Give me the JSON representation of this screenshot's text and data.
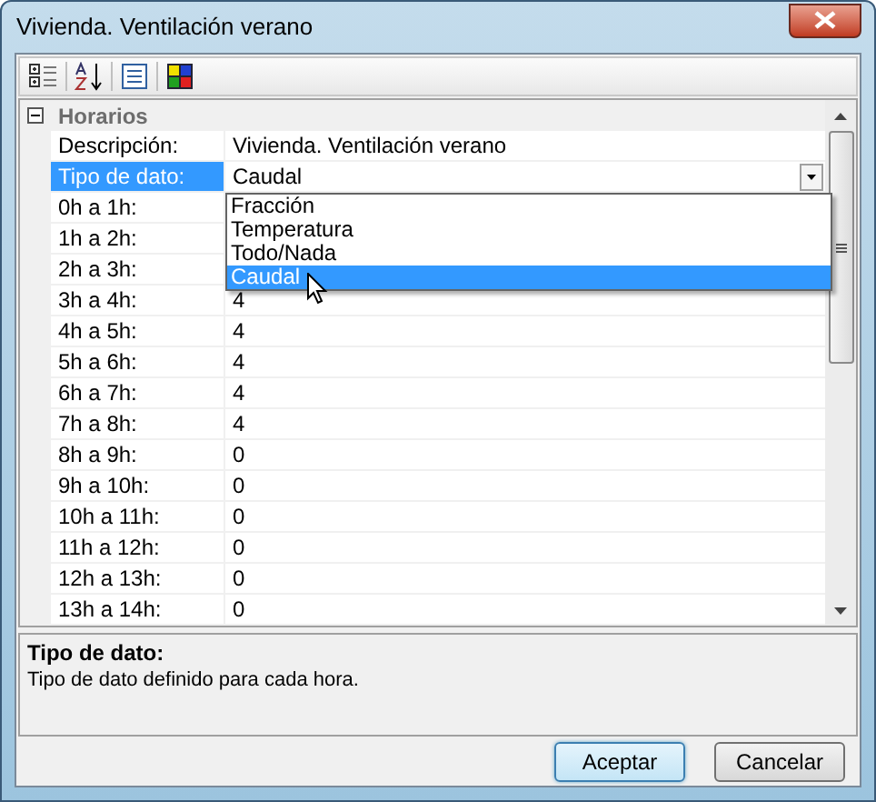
{
  "window": {
    "title": "Vivienda. Ventilación verano"
  },
  "grid": {
    "category": {
      "label": "Horarios",
      "expanded": true
    },
    "rows": [
      {
        "label": "Descripción:",
        "value": "Vivienda. Ventilación verano",
        "selected": false
      },
      {
        "label": "Tipo de dato:",
        "value": "Caudal",
        "selected": true,
        "kind": "dropdown"
      },
      {
        "label": "0h a 1h:",
        "selected": false
      },
      {
        "label": "1h a 2h:",
        "selected": false
      },
      {
        "label": "2h a 3h:",
        "selected": false
      },
      {
        "label": "3h a 4h:",
        "value": "4",
        "selected": false
      },
      {
        "label": "4h a 5h:",
        "value": "4",
        "selected": false
      },
      {
        "label": "5h a 6h:",
        "value": "4",
        "selected": false
      },
      {
        "label": "6h a 7h:",
        "value": "4",
        "selected": false
      },
      {
        "label": "7h a 8h:",
        "value": "4",
        "selected": false
      },
      {
        "label": "8h a 9h:",
        "value": "0",
        "selected": false
      },
      {
        "label": "9h a 10h:",
        "value": "0",
        "selected": false
      },
      {
        "label": "10h a 11h:",
        "value": "0",
        "selected": false
      },
      {
        "label": "11h a 12h:",
        "value": "0",
        "selected": false
      },
      {
        "label": "12h a 13h:",
        "value": "0",
        "selected": false
      },
      {
        "label": "13h a 14h:",
        "value": "0",
        "selected": false
      }
    ],
    "dropdown": {
      "options": [
        {
          "label": "Fracción",
          "selected": false
        },
        {
          "label": "Temperatura",
          "selected": false
        },
        {
          "label": "Todo/Nada",
          "selected": false
        },
        {
          "label": "Caudal",
          "selected": true
        }
      ]
    }
  },
  "description": {
    "title": "Tipo de dato:",
    "text": "Tipo de dato definido para cada hora."
  },
  "buttons": [
    {
      "label": "Aceptar",
      "kind": "default"
    },
    {
      "label": "Cancelar",
      "kind": "normal"
    }
  ]
}
